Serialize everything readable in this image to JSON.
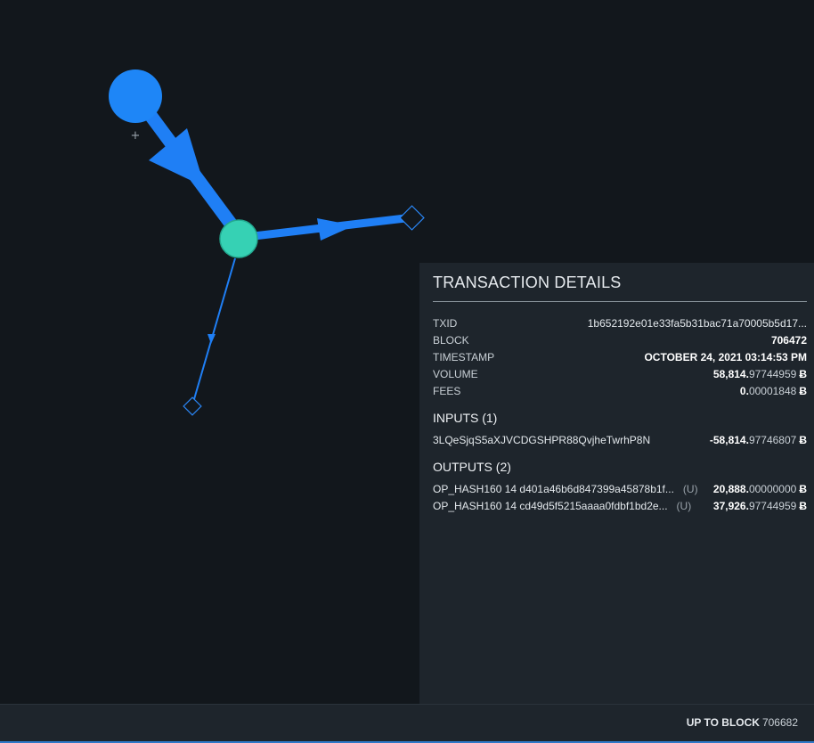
{
  "graph": {
    "add_label": "+"
  },
  "panel": {
    "title": "TRANSACTION DETAILS",
    "fields": {
      "txid": {
        "label": "TXID",
        "value": "1b652192e01e33fa5b31bac71a70005b5d17..."
      },
      "block": {
        "label": "BLOCK",
        "value": "706472"
      },
      "timestamp": {
        "label": "TIMESTAMP",
        "value": "OCTOBER 24, 2021 03:14:53 PM"
      },
      "volume": {
        "label": "VOLUME",
        "value_strong": "58,814.",
        "value_dim": "97744959",
        "unit": "Ƀ"
      },
      "fees": {
        "label": "FEES",
        "value_strong": "0.",
        "value_dim": "00001848",
        "unit": "Ƀ"
      }
    },
    "inputs": {
      "title": "INPUTS (1)",
      "items": [
        {
          "address": "3LQeSjqS5aXJVCDGSHPR88QvjheTwrhP8N",
          "amount_strong": "-58,814.",
          "amount_dim": "97746807",
          "unit": "Ƀ"
        }
      ]
    },
    "outputs": {
      "title": "OUTPUTS (2)",
      "items": [
        {
          "address": "OP_HASH160 14 d401a46b6d847399a45878b1f...",
          "tag": "(U)",
          "amount_strong": "20,888.",
          "amount_dim": "00000000",
          "unit": "Ƀ"
        },
        {
          "address": "OP_HASH160 14 cd49d5f5215aaaa0fdbf1bd2e...",
          "tag": "(U)",
          "amount_strong": "37,926.",
          "amount_dim": "97744959",
          "unit": "Ƀ"
        }
      ]
    }
  },
  "footer": {
    "label": "UP TO BLOCK",
    "value": "706682"
  },
  "colors": {
    "edge": "#1f7ff5",
    "address_node": "#1e86f7",
    "tx_node": "#36d1b4",
    "background": "#12171c",
    "panel": "#1e252c"
  }
}
